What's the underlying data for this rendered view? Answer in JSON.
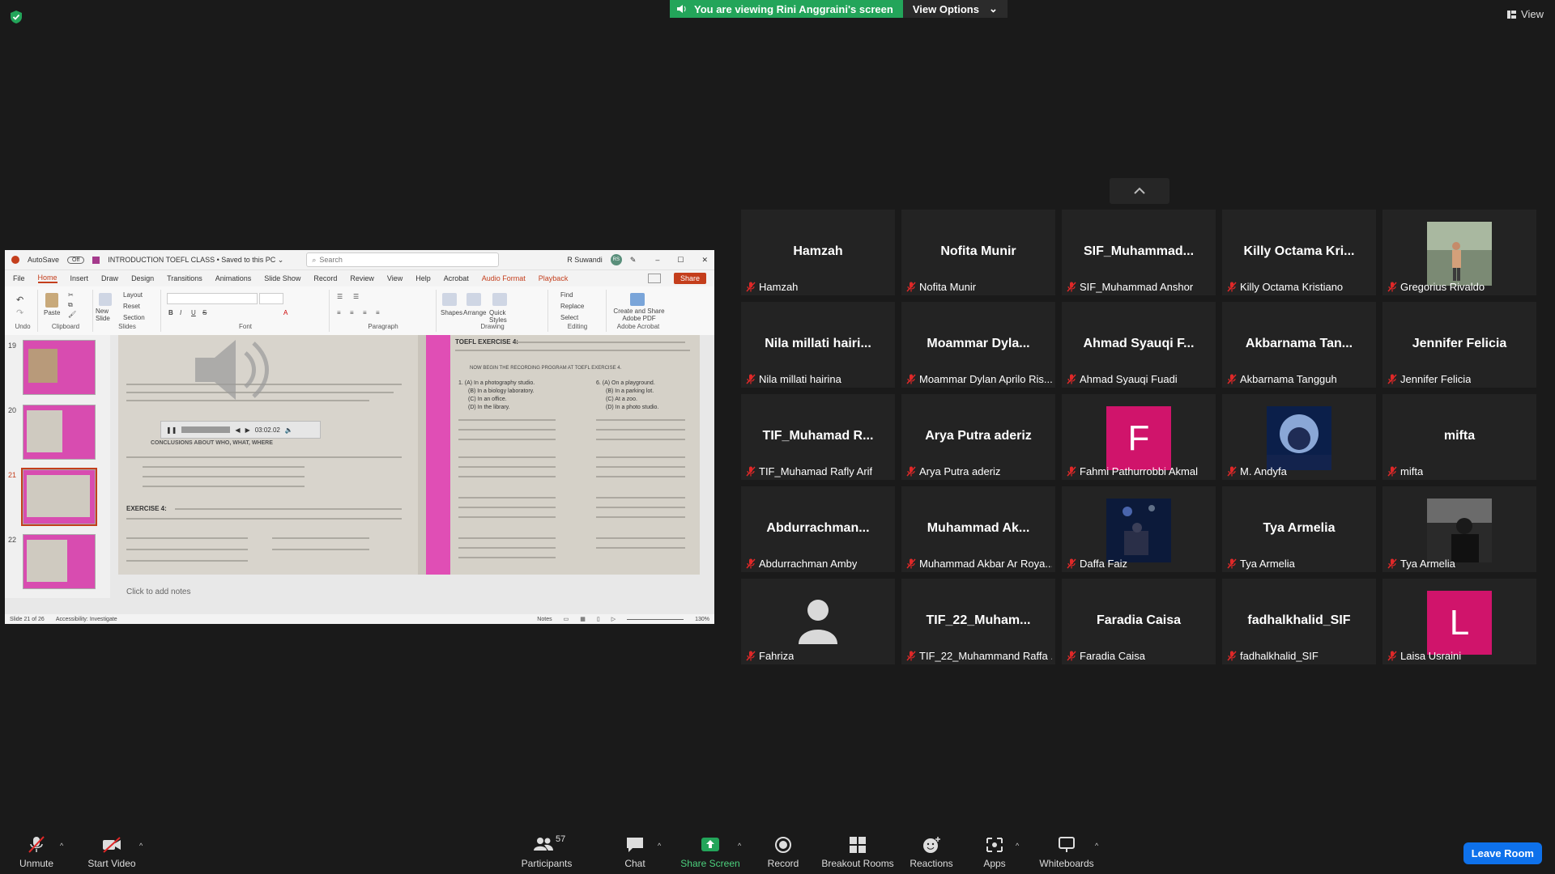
{
  "banner": {
    "viewing": "You are viewing Rini Anggraini's screen",
    "view_options": "View Options"
  },
  "view_label": "View",
  "powerpoint": {
    "autosave": "AutoSave",
    "autosave_state": "Off",
    "filename": "INTRODUCTION TOEFL CLASS • Saved to this PC ⌄",
    "search": "Search",
    "user": "R Suwandi",
    "user_initials": "RS",
    "share": "Share",
    "menu": [
      "File",
      "Home",
      "Insert",
      "Draw",
      "Design",
      "Transitions",
      "Animations",
      "Slide Show",
      "Record",
      "Review",
      "View",
      "Help",
      "Acrobat",
      "Audio Format",
      "Playback"
    ],
    "ribbon_groups": [
      "Undo",
      "Clipboard",
      "Slides",
      "Font",
      "Paragraph",
      "Drawing",
      "Editing",
      "Adobe Acrobat"
    ],
    "ribbon_labels": {
      "paste": "Paste",
      "new_slide": "New Slide",
      "layout": "Layout",
      "reset": "Reset",
      "section": "Section",
      "shapes": "Shapes",
      "arrange": "Arrange",
      "quick_styles": "Quick Styles",
      "find": "Find",
      "replace": "Replace",
      "select": "Select",
      "create_pdf": "Create and Share Adobe PDF"
    },
    "thumb_numbers": [
      "19",
      "20",
      "21",
      "22"
    ],
    "slide_text": {
      "exercise_title": "TOEFL EXERCISE 4:",
      "exercise_line": "NOW BEGIN THE RECORDING PROGRAM AT TOEFL EXERCISE 4.",
      "conclusions": "CONCLUSIONS ABOUT WHO, WHAT, WHERE",
      "exercise_left": "EXERCISE 4:",
      "q1": "1. (A) In a photography studio.",
      "q2": "(B) In a biology laboratory.",
      "q3": "(C) In an office.",
      "q4": "(D) In the library.",
      "q5": "6. (A) On a playground.",
      "q6": "(B) In a parking lot.",
      "q7": "(C) At a zoo.",
      "q8": "(D) In a photo studio."
    },
    "audio_time": "03:02.02",
    "notes": "Click to add notes",
    "status": {
      "slide": "Slide 21 of 26",
      "accessibility": "Accessibility: Investigate",
      "notes": "Notes",
      "zoom": "130%"
    }
  },
  "participants": [
    {
      "name": "Hamzah",
      "label": "Hamzah"
    },
    {
      "name": "Nofita Munir",
      "label": "Nofita Munir"
    },
    {
      "name": "SIF_Muhammad...",
      "label": "SIF_Muhammad Anshor"
    },
    {
      "name": "Killy Octama Kri...",
      "label": "Killy Octama Kristiano"
    },
    {
      "name": "",
      "label": "Gregorius Rivaldo",
      "image": "photo"
    },
    {
      "name": "Nila millati hairi...",
      "label": "Nila millati hairina"
    },
    {
      "name": "Moammar Dyla...",
      "label": "Moammar Dylan Aprilo Ris..."
    },
    {
      "name": "Ahmad Syauqi F...",
      "label": "Ahmad Syauqi Fuadi"
    },
    {
      "name": "Akbarnama Tan...",
      "label": "Akbarnama Tangguh"
    },
    {
      "name": "Jennifer Felicia",
      "label": "Jennifer Felicia"
    },
    {
      "name": "TIF_Muhamad R...",
      "label": "TIF_Muhamad Rafly Arif"
    },
    {
      "name": "Arya Putra aderiz",
      "label": "Arya Putra aderiz"
    },
    {
      "name": "",
      "label": "Fahmi Pathurrobbi Akmal",
      "letter": "F",
      "color": "#d0146b"
    },
    {
      "name": "",
      "label": "M. Andyfa",
      "image": "moon"
    },
    {
      "name": "mifta",
      "label": "mifta"
    },
    {
      "name": "Abdurrachman...",
      "label": "Abdurrachman Amby"
    },
    {
      "name": "Muhammad Ak...",
      "label": "Muhammad Akbar Ar Roya..."
    },
    {
      "name": "",
      "label": "Daffa Faiz",
      "image": "stage"
    },
    {
      "name": "Tya Armelia",
      "label": "Tya Armelia"
    },
    {
      "name": "",
      "label": "Tya Armelia",
      "image": "dark"
    },
    {
      "name": "",
      "label": "Fahriza",
      "image": "default"
    },
    {
      "name": "TIF_22_Muham...",
      "label": "TIF_22_Muhammand Raffa ..."
    },
    {
      "name": "Faradia Caisa",
      "label": "Faradia Caisa"
    },
    {
      "name": "fadhalkhalid_SIF",
      "label": "fadhalkhalid_SIF"
    },
    {
      "name": "",
      "label": "Laisa Usraini",
      "letter": "L",
      "color": "#d0146b"
    }
  ],
  "toolbar": {
    "unmute": "Unmute",
    "start_video": "Start Video",
    "participants": "Participants",
    "participants_count": "57",
    "chat": "Chat",
    "share_screen": "Share Screen",
    "record": "Record",
    "breakout": "Breakout Rooms",
    "reactions": "Reactions",
    "apps": "Apps",
    "whiteboards": "Whiteboards",
    "leave": "Leave Room"
  },
  "colors": {
    "share_green": "#23a55a",
    "leave_blue": "#0e71eb",
    "mic_off_red": "#e02828",
    "slide_pink": "#e04eb5"
  }
}
